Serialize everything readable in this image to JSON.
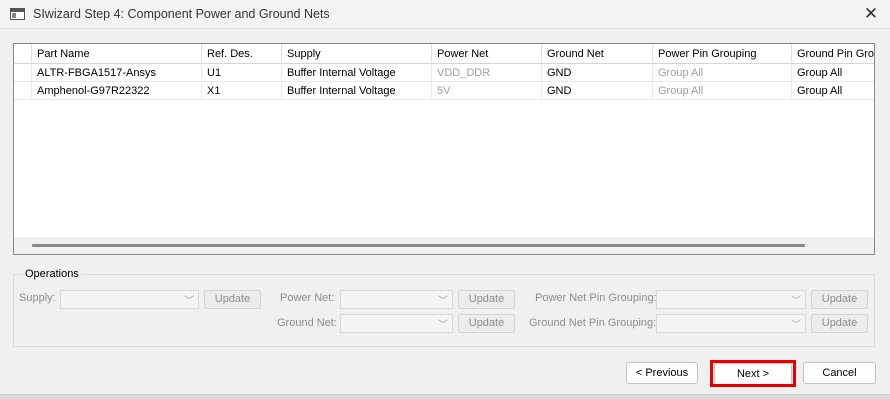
{
  "window": {
    "title": "SIwizard Step 4: Component Power and Ground Nets",
    "close_glyph": "✕"
  },
  "grid": {
    "headers": [
      "",
      "Part Name",
      "Ref. Des.",
      "Supply",
      "Power Net",
      "Ground Net",
      "Power Pin Grouping",
      "Ground Pin Grou"
    ],
    "rows": [
      {
        "part": "ALTR-FBGA1517-Ansys",
        "ref": "U1",
        "supply": "Buffer Internal Voltage",
        "power_net": "VDD_DDR",
        "ground_net": "GND",
        "power_group": "Group All",
        "ground_group": "Group All"
      },
      {
        "part": "Amphenol-G97R22322",
        "ref": "X1",
        "supply": "Buffer Internal Voltage",
        "power_net": "5V",
        "ground_net": "GND",
        "power_group": "Group All",
        "ground_group": "Group All"
      }
    ]
  },
  "operations": {
    "legend": "Operations",
    "supply_label": "Supply:",
    "power_net_label": "Power Net:",
    "ground_net_label": "Ground Net:",
    "power_pin_label": "Power Net Pin Grouping:",
    "ground_pin_label": "Ground Net Pin Grouping:",
    "update_label": "Update",
    "chevron_glyph": "﹀"
  },
  "footer": {
    "previous": "< Previous",
    "next": "Next >",
    "cancel": "Cancel"
  },
  "colors": {
    "highlight": "#e60000",
    "disabled_text": "#a0a0a0"
  }
}
